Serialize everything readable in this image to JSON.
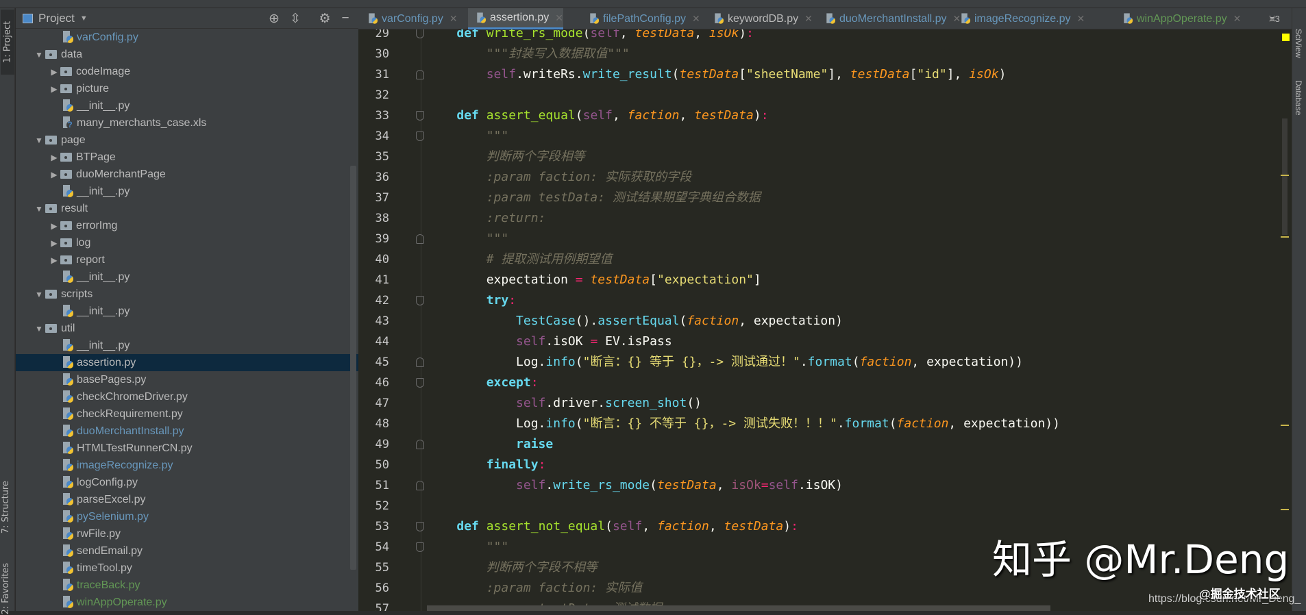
{
  "left_strip": {
    "project": "1: Project",
    "structure": "7: Structure",
    "favorites": "2: Favorites"
  },
  "right_strip": {
    "sciview": "SciView",
    "database": "Database"
  },
  "panel": {
    "title": "Project",
    "icons": [
      "locate-icon",
      "collapse-all-icon",
      "gear-icon",
      "hide-icon"
    ]
  },
  "tree": [
    {
      "label": "varConfig.py",
      "type": "py",
      "depth": 2,
      "color": "blue"
    },
    {
      "label": "data",
      "type": "folder",
      "depth": 1,
      "expanded": true
    },
    {
      "label": "codeImage",
      "type": "folder",
      "depth": 2,
      "expanded": false
    },
    {
      "label": "picture",
      "type": "folder",
      "depth": 2,
      "expanded": false
    },
    {
      "label": "__init__.py",
      "type": "py",
      "depth": 2
    },
    {
      "label": "many_merchants_case.xls",
      "type": "unknown",
      "depth": 2
    },
    {
      "label": "page",
      "type": "folder",
      "depth": 1,
      "expanded": true
    },
    {
      "label": "BTPage",
      "type": "folder",
      "depth": 2,
      "expanded": false
    },
    {
      "label": "duoMerchantPage",
      "type": "folder",
      "depth": 2,
      "expanded": false
    },
    {
      "label": "__init__.py",
      "type": "py",
      "depth": 2
    },
    {
      "label": "result",
      "type": "folder",
      "depth": 1,
      "expanded": true
    },
    {
      "label": "errorImg",
      "type": "folder",
      "depth": 2,
      "expanded": false
    },
    {
      "label": "log",
      "type": "folder",
      "depth": 2,
      "expanded": false
    },
    {
      "label": "report",
      "type": "folder",
      "depth": 2,
      "expanded": false
    },
    {
      "label": "__init__.py",
      "type": "py",
      "depth": 2
    },
    {
      "label": "scripts",
      "type": "folder",
      "depth": 1,
      "expanded": true
    },
    {
      "label": "__init__.py",
      "type": "py",
      "depth": 2
    },
    {
      "label": "util",
      "type": "folder",
      "depth": 1,
      "expanded": true
    },
    {
      "label": "__init__.py",
      "type": "py",
      "depth": 2
    },
    {
      "label": "assertion.py",
      "type": "py",
      "depth": 2,
      "selected": true
    },
    {
      "label": "basePages.py",
      "type": "py",
      "depth": 2
    },
    {
      "label": "checkChromeDriver.py",
      "type": "py",
      "depth": 2
    },
    {
      "label": "checkRequirement.py",
      "type": "py",
      "depth": 2
    },
    {
      "label": "duoMerchantInstall.py",
      "type": "py",
      "depth": 2,
      "color": "blue"
    },
    {
      "label": "HTMLTestRunnerCN.py",
      "type": "py",
      "depth": 2
    },
    {
      "label": "imageRecognize.py",
      "type": "py",
      "depth": 2,
      "color": "blue"
    },
    {
      "label": "logConfig.py",
      "type": "py",
      "depth": 2
    },
    {
      "label": "parseExcel.py",
      "type": "py",
      "depth": 2
    },
    {
      "label": "pySelenium.py",
      "type": "py",
      "depth": 2,
      "color": "blue"
    },
    {
      "label": "rwFile.py",
      "type": "py",
      "depth": 2
    },
    {
      "label": "sendEmail.py",
      "type": "py",
      "depth": 2
    },
    {
      "label": "timeTool.py",
      "type": "py",
      "depth": 2
    },
    {
      "label": "traceBack.py",
      "type": "py",
      "depth": 2,
      "color": "green"
    },
    {
      "label": "winAppOperate.py",
      "type": "py",
      "depth": 2,
      "color": "green"
    }
  ],
  "tabs": [
    {
      "label": "varConfig.py",
      "color": "blue"
    },
    {
      "label": "assertion.py",
      "active": true
    },
    {
      "label": "filePathConfig.py",
      "color": "blue"
    },
    {
      "label": "keywordDB.py"
    },
    {
      "label": "duoMerchantInstall.py",
      "color": "blue"
    },
    {
      "label": "imageRecognize.py",
      "color": "blue"
    },
    {
      "label": "winAppOperate.py",
      "color": "green"
    }
  ],
  "tab_overflow": "≡3",
  "code": [
    {
      "n": "29",
      "fold": "start",
      "ind": "    ",
      "tk": [
        [
          "kw",
          "def"
        ],
        [
          "",
          ""
        ],
        [
          "fn",
          " write_rs_mode"
        ],
        [
          "",
          "("
        ],
        [
          "self",
          "self"
        ],
        [
          "",
          ", "
        ],
        [
          "param",
          "testData"
        ],
        [
          "",
          ", "
        ],
        [
          "param",
          "isOk"
        ],
        [
          "",
          ")"
        ],
        [
          "colon",
          ":"
        ]
      ]
    },
    {
      "n": "30",
      "ind": "        ",
      "tk": [
        [
          "doc",
          "\"\"\"封装写入数据取值\"\"\""
        ]
      ]
    },
    {
      "n": "31",
      "fold": "end",
      "ind": "        ",
      "tk": [
        [
          "self",
          "self"
        ],
        [
          "",
          ".writeRs."
        ],
        [
          "call",
          "write_result"
        ],
        [
          "",
          "("
        ],
        [
          "param",
          "testData"
        ],
        [
          "",
          "["
        ],
        [
          "str",
          "\"sheetName\""
        ],
        [
          "",
          "], "
        ],
        [
          "param",
          "testData"
        ],
        [
          "",
          "["
        ],
        [
          "str",
          "\"id\""
        ],
        [
          "",
          "], "
        ],
        [
          "param",
          "isOk"
        ],
        [
          "",
          ")"
        ]
      ]
    },
    {
      "n": "32",
      "ind": "",
      "tk": []
    },
    {
      "n": "33",
      "fold": "start",
      "ind": "    ",
      "tk": [
        [
          "kw",
          "def"
        ],
        [
          "fn",
          " assert_equal"
        ],
        [
          "",
          "("
        ],
        [
          "self",
          "self"
        ],
        [
          "",
          ", "
        ],
        [
          "param",
          "faction"
        ],
        [
          "",
          ", "
        ],
        [
          "param",
          "testData"
        ],
        [
          "",
          ")"
        ],
        [
          "colon",
          ":"
        ]
      ]
    },
    {
      "n": "34",
      "fold": "start",
      "ind": "        ",
      "tk": [
        [
          "doc",
          "\"\"\""
        ]
      ]
    },
    {
      "n": "35",
      "ind": "        ",
      "tk": [
        [
          "doc",
          "判断两个字段相等"
        ]
      ]
    },
    {
      "n": "36",
      "ind": "        ",
      "tk": [
        [
          "doc",
          ":param faction: 实际获取的字段"
        ]
      ]
    },
    {
      "n": "37",
      "ind": "        ",
      "tk": [
        [
          "doc",
          ":param testData: 测试结果期望字典组合数据"
        ]
      ]
    },
    {
      "n": "38",
      "ind": "        ",
      "tk": [
        [
          "doc",
          ":return:"
        ]
      ]
    },
    {
      "n": "39",
      "fold": "end",
      "ind": "        ",
      "tk": [
        [
          "doc",
          "\"\"\""
        ]
      ]
    },
    {
      "n": "40",
      "ind": "        ",
      "tk": [
        [
          "cm",
          "# 提取测试用例期望值"
        ]
      ]
    },
    {
      "n": "41",
      "ind": "        ",
      "tk": [
        [
          "",
          "expectation "
        ],
        [
          "op",
          "="
        ],
        [
          "",
          " "
        ],
        [
          "param",
          "testData"
        ],
        [
          "",
          "["
        ],
        [
          "str",
          "\"expectation\""
        ],
        [
          "",
          "]"
        ]
      ]
    },
    {
      "n": "42",
      "fold": "start",
      "ind": "        ",
      "tk": [
        [
          "kw",
          "try"
        ],
        [
          "colon",
          ":"
        ]
      ]
    },
    {
      "n": "43",
      "ind": "            ",
      "tk": [
        [
          "cls",
          "TestCase"
        ],
        [
          "",
          "()."
        ],
        [
          "call",
          "assertEqual"
        ],
        [
          "",
          "("
        ],
        [
          "param",
          "faction"
        ],
        [
          "",
          ", expectation)"
        ]
      ]
    },
    {
      "n": "44",
      "ind": "            ",
      "tk": [
        [
          "self",
          "self"
        ],
        [
          "",
          ".isOK "
        ],
        [
          "op",
          "="
        ],
        [
          "",
          " EV.isPass"
        ]
      ]
    },
    {
      "n": "45",
      "fold": "end",
      "ind": "            ",
      "tk": [
        [
          "",
          "Log."
        ],
        [
          "call",
          "info"
        ],
        [
          "",
          "("
        ],
        [
          "str",
          "\"断言：{} 等于 {}，-> 测试通过！\""
        ],
        [
          "",
          "."
        ],
        [
          "call",
          "format"
        ],
        [
          "",
          "("
        ],
        [
          "param",
          "faction"
        ],
        [
          "",
          ", expectation))"
        ]
      ]
    },
    {
      "n": "46",
      "fold": "start",
      "ind": "        ",
      "tk": [
        [
          "kw",
          "except"
        ],
        [
          "colon",
          ":"
        ]
      ]
    },
    {
      "n": "47",
      "ind": "            ",
      "tk": [
        [
          "self",
          "self"
        ],
        [
          "",
          ".driver."
        ],
        [
          "call",
          "screen_shot"
        ],
        [
          "",
          "()"
        ]
      ]
    },
    {
      "n": "48",
      "ind": "            ",
      "tk": [
        [
          "",
          "Log."
        ],
        [
          "call",
          "info"
        ],
        [
          "",
          "("
        ],
        [
          "str",
          "\"断言：{} 不等于 {}，-> 测试失败！！！\""
        ],
        [
          "",
          "."
        ],
        [
          "call",
          "format"
        ],
        [
          "",
          "("
        ],
        [
          "param",
          "faction"
        ],
        [
          "",
          ", expectation))"
        ]
      ]
    },
    {
      "n": "49",
      "fold": "end",
      "ind": "            ",
      "tk": [
        [
          "kw",
          "raise"
        ]
      ]
    },
    {
      "n": "50",
      "ind": "        ",
      "tk": [
        [
          "kw",
          "finally"
        ],
        [
          "colon",
          ":"
        ]
      ]
    },
    {
      "n": "51",
      "fold": "end",
      "ind": "            ",
      "tk": [
        [
          "self",
          "self"
        ],
        [
          "",
          "."
        ],
        [
          "call",
          "write_rs_mode"
        ],
        [
          "",
          "("
        ],
        [
          "param",
          "testData"
        ],
        [
          "",
          ", "
        ],
        [
          "kwarg",
          "isOk"
        ],
        [
          "op",
          "="
        ],
        [
          "self",
          "self"
        ],
        [
          "",
          ".isOK)"
        ]
      ]
    },
    {
      "n": "52",
      "ind": "",
      "tk": []
    },
    {
      "n": "53",
      "fold": "start",
      "ind": "    ",
      "tk": [
        [
          "kw",
          "def"
        ],
        [
          "fn",
          " assert_not_equal"
        ],
        [
          "",
          "("
        ],
        [
          "self",
          "self"
        ],
        [
          "",
          ", "
        ],
        [
          "param",
          "faction"
        ],
        [
          "",
          ", "
        ],
        [
          "param",
          "testData"
        ],
        [
          "",
          ")"
        ],
        [
          "colon",
          ":"
        ]
      ]
    },
    {
      "n": "54",
      "fold": "start",
      "ind": "        ",
      "tk": [
        [
          "doc",
          "\"\"\""
        ]
      ]
    },
    {
      "n": "55",
      "ind": "        ",
      "tk": [
        [
          "doc",
          "判断两个字段不相等"
        ]
      ]
    },
    {
      "n": "56",
      "ind": "        ",
      "tk": [
        [
          "doc",
          ":param faction: 实际值"
        ]
      ]
    },
    {
      "n": "57",
      "ind": "        ",
      "tk": [
        [
          "doc",
          ":param testData: 测试数据"
        ]
      ]
    }
  ],
  "watermark": {
    "main": "知乎 @Mr.Deng",
    "sub": "@掘金技术社区",
    "url": "https://blog.csdn.net/Mr_Deng_"
  }
}
